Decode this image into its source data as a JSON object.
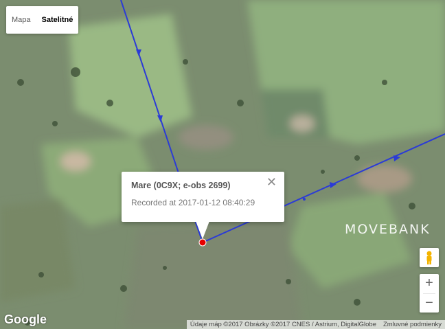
{
  "map_type": {
    "options": [
      "Mapa",
      "Satelitné"
    ],
    "selected": "Satelitné"
  },
  "info_window": {
    "title": "Mare (0C9X; e-obs 2699)",
    "subtitle": "Recorded at 2017-01-12 08:40:29"
  },
  "watermark": "MOVEBANK",
  "zoom": {
    "in_label": "+",
    "out_label": "−"
  },
  "logo_text": "Google",
  "attribution": {
    "data": "Údaje máp ©2017 Obrázky ©2017 CNES / Astrium, DigitalGlobe",
    "terms": "Zmluvné podmienky"
  },
  "colors": {
    "track": "#2b3bd6",
    "marker": "#e60000",
    "terrain": "#7c8f6e"
  },
  "icons": [
    "close-icon",
    "pegman-icon",
    "zoom-in-icon",
    "zoom-out-icon",
    "direction-arrow-icon"
  ]
}
